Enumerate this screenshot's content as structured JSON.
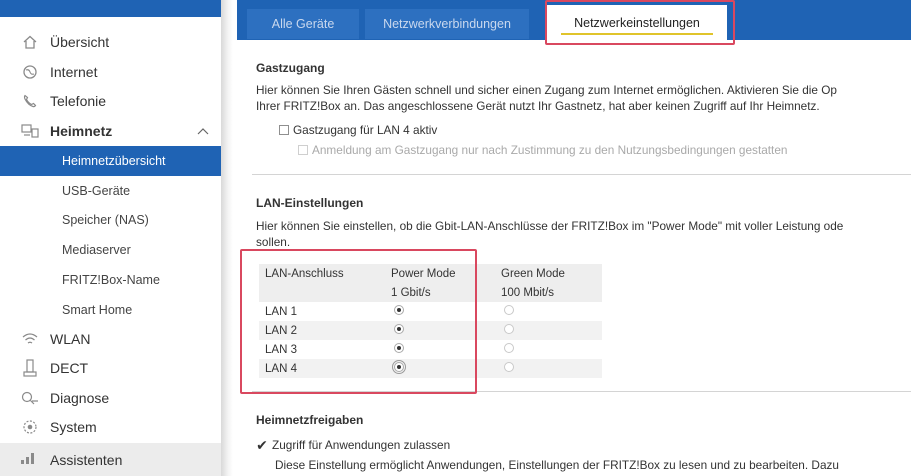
{
  "sidebar": {
    "items": [
      {
        "label": "Übersicht",
        "icon": "home-icon"
      },
      {
        "label": "Internet",
        "icon": "globe-icon"
      },
      {
        "label": "Telefonie",
        "icon": "phone-icon"
      },
      {
        "label": "Heimnetz",
        "icon": "network-icon"
      }
    ],
    "sub_items": [
      {
        "label": "Heimnetzübersicht"
      },
      {
        "label": "USB-Geräte"
      },
      {
        "label": "Speicher (NAS)"
      },
      {
        "label": "Mediaserver"
      },
      {
        "label": "FRITZ!Box-Name"
      },
      {
        "label": "Smart Home"
      }
    ],
    "items_lower": [
      {
        "label": "WLAN",
        "icon": "wifi-icon"
      },
      {
        "label": "DECT",
        "icon": "dect-phone-icon"
      },
      {
        "label": "Diagnose",
        "icon": "diagnose-icon"
      },
      {
        "label": "System",
        "icon": "system-icon"
      }
    ],
    "assistant": {
      "label": "Assistenten",
      "icon": "assistant-icon"
    }
  },
  "tabs": [
    {
      "label": "Alle Geräte"
    },
    {
      "label": "Netzwerkverbindungen"
    },
    {
      "label": "Netzwerkeinstellungen"
    }
  ],
  "guest": {
    "title": "Gastzugang",
    "line1": "Hier können Sie Ihren Gästen schnell und sicher einen Zugang zum Internet ermöglichen. Aktivieren Sie die Op",
    "line2": "Ihrer FRITZ!Box an. Das angeschlossene Gerät nutzt Ihr Gastnetz, hat aber keinen Zugriff auf Ihr Heimnetz.",
    "check_lan4": "Gastzugang für LAN 4 aktiv",
    "check_consent": "Anmeldung am Gastzugang nur nach Zustimmung zu den Nutzungsbedingungen gestatten"
  },
  "lan": {
    "title": "LAN-Einstellungen",
    "line1": "Hier können Sie einstellen, ob die Gbit-LAN-Anschlüsse der FRITZ!Box im \"Power Mode\" mit voller Leistung ode",
    "line2": "sollen.",
    "headers": {
      "port": "LAN-Anschluss",
      "power": "Power Mode",
      "green": "Green Mode"
    },
    "subheaders": {
      "power": "1 Gbit/s",
      "green": "100 Mbit/s"
    },
    "rows": [
      {
        "port": "LAN 1",
        "mode": "power"
      },
      {
        "port": "LAN 2",
        "mode": "power"
      },
      {
        "port": "LAN 3",
        "mode": "power"
      },
      {
        "port": "LAN 4",
        "mode": "power"
      }
    ]
  },
  "share": {
    "title": "Heimnetzfreigaben",
    "check_apps": "Zugriff für Anwendungen zulassen",
    "desc": "Diese Einstellung ermöglicht Anwendungen, Einstellungen der FRITZ!Box zu lesen und zu bearbeiten. Dazu"
  },
  "colors": {
    "accent": "#1f63b4",
    "highlight": "#d9485f",
    "tab_underline": "#e0c42b"
  }
}
